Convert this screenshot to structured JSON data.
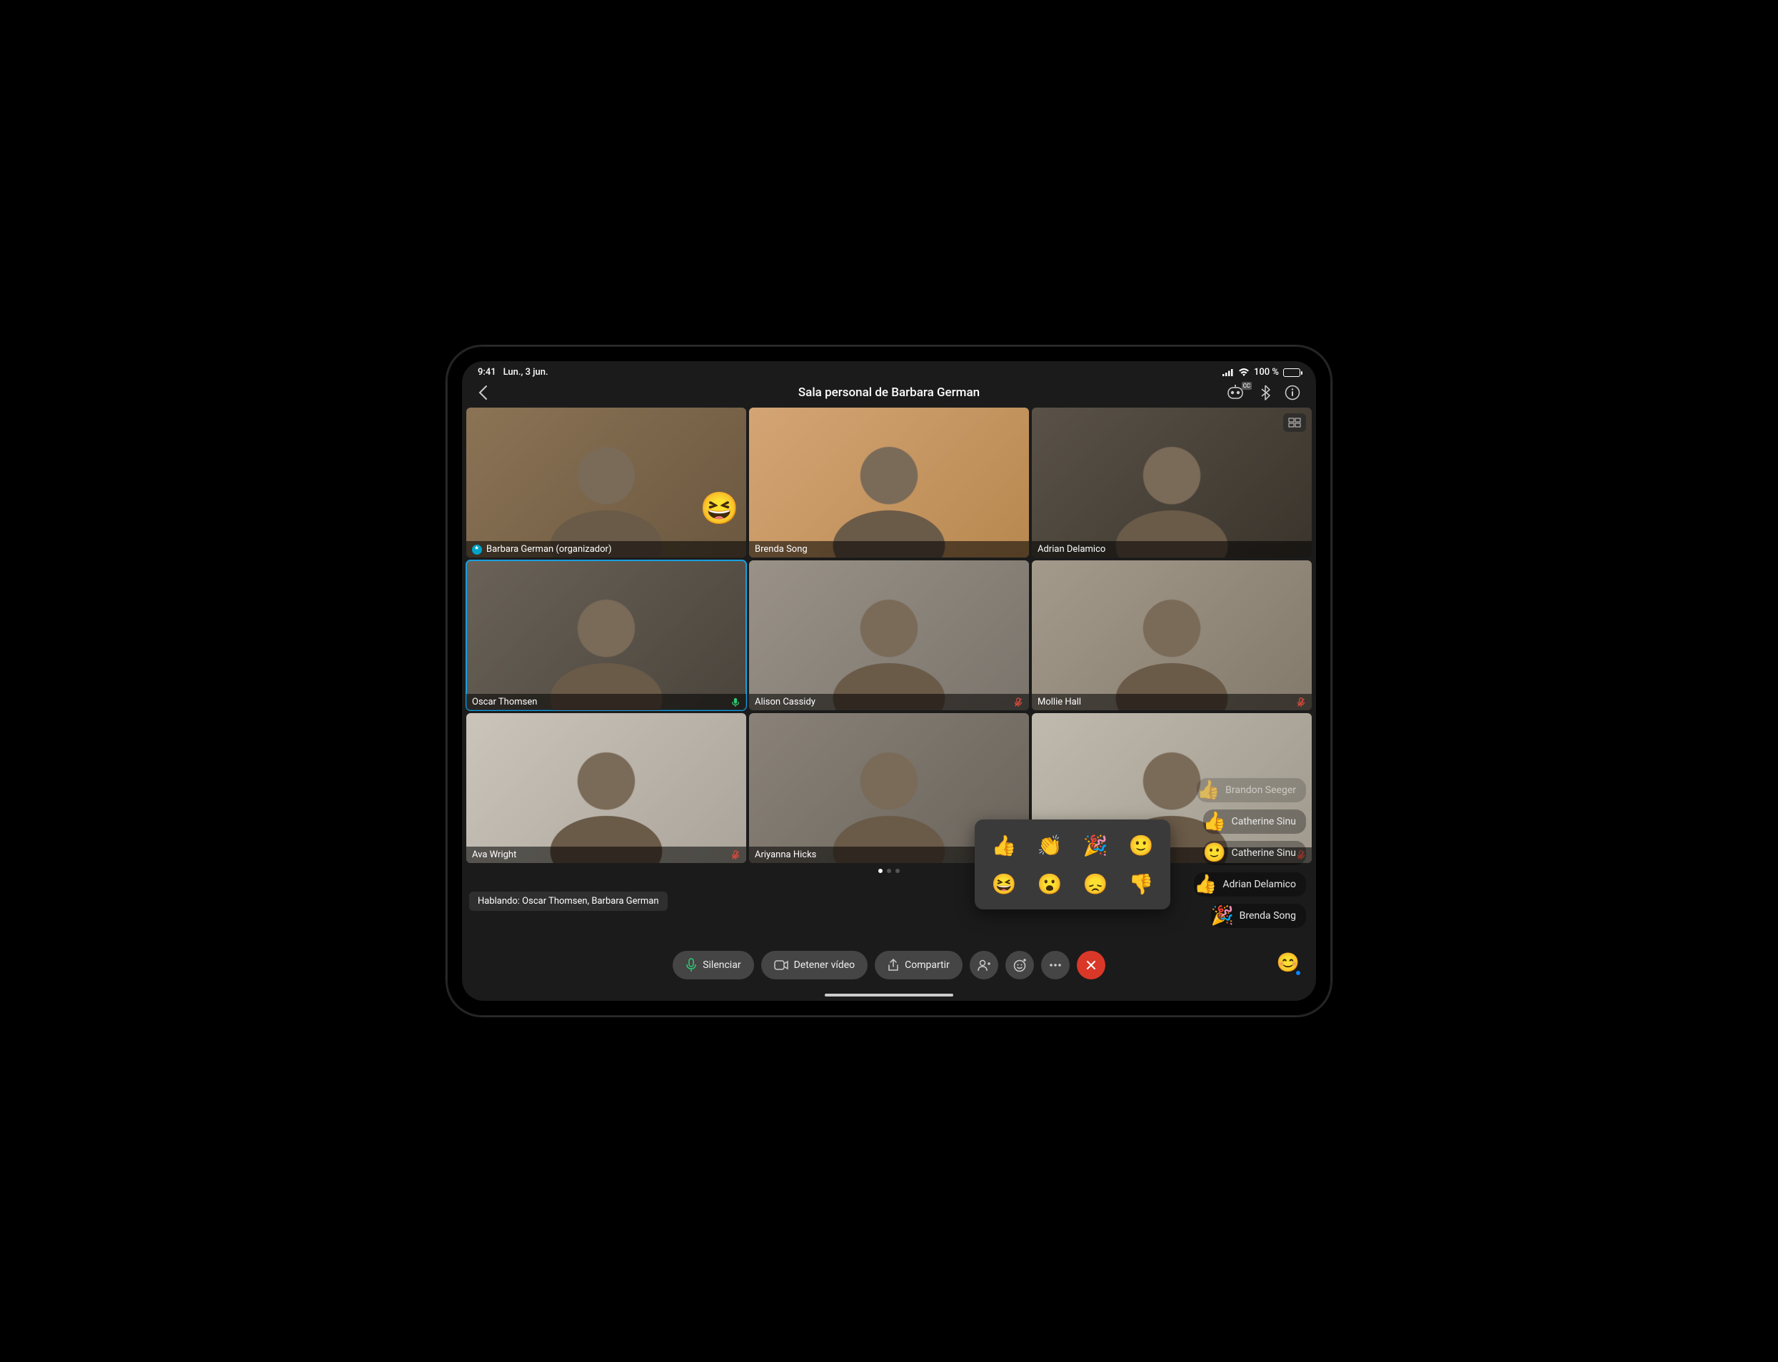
{
  "statusbar": {
    "time": "9:41",
    "date": "Lun., 3 jun.",
    "battery": "100 %"
  },
  "header": {
    "title": "Sala personal de Barbara German"
  },
  "participants": [
    {
      "name": "Barbara German (organizador)",
      "host": true,
      "active": false,
      "mic": "none",
      "reaction": "😆"
    },
    {
      "name": "Brenda Song",
      "host": false,
      "active": false,
      "mic": "none",
      "reaction": ""
    },
    {
      "name": "Adrian Delamico",
      "host": false,
      "active": false,
      "mic": "none",
      "reaction": ""
    },
    {
      "name": "Oscar Thomsen",
      "host": false,
      "active": true,
      "mic": "green",
      "reaction": ""
    },
    {
      "name": "Alison Cassidy",
      "host": false,
      "active": false,
      "mic": "red",
      "reaction": ""
    },
    {
      "name": "Mollie Hall",
      "host": false,
      "active": false,
      "mic": "red",
      "reaction": ""
    },
    {
      "name": "Ava Wright",
      "host": false,
      "active": false,
      "mic": "red",
      "reaction": ""
    },
    {
      "name": "Ariyanna Hicks",
      "host": false,
      "active": false,
      "mic": "none",
      "reaction": ""
    },
    {
      "name": "",
      "host": false,
      "active": false,
      "mic": "red",
      "reaction": ""
    }
  ],
  "speaking": {
    "text": "Hablando: Oscar Thomsen, Barbara German"
  },
  "reactions_popup": [
    "👍",
    "👏",
    "🎉",
    "🙂",
    "😆",
    "😮",
    "😞",
    "👎"
  ],
  "recent_reactions": [
    {
      "emoji": "👍",
      "name": "Brandon Seeger",
      "faded": true
    },
    {
      "emoji": "👍",
      "name": "Catherine Sinu",
      "faded": false
    },
    {
      "emoji": "🙂",
      "name": "Catherine Sinu",
      "faded": false
    },
    {
      "emoji": "👍",
      "name": "Adrian Delamico",
      "faded": false
    },
    {
      "emoji": "🎉",
      "name": "Brenda Song",
      "faded": false
    }
  ],
  "toolbar": {
    "mute": "Silenciar",
    "video": "Detener vídeo",
    "share": "Compartir"
  },
  "pager": {
    "total": 3,
    "active": 0
  }
}
